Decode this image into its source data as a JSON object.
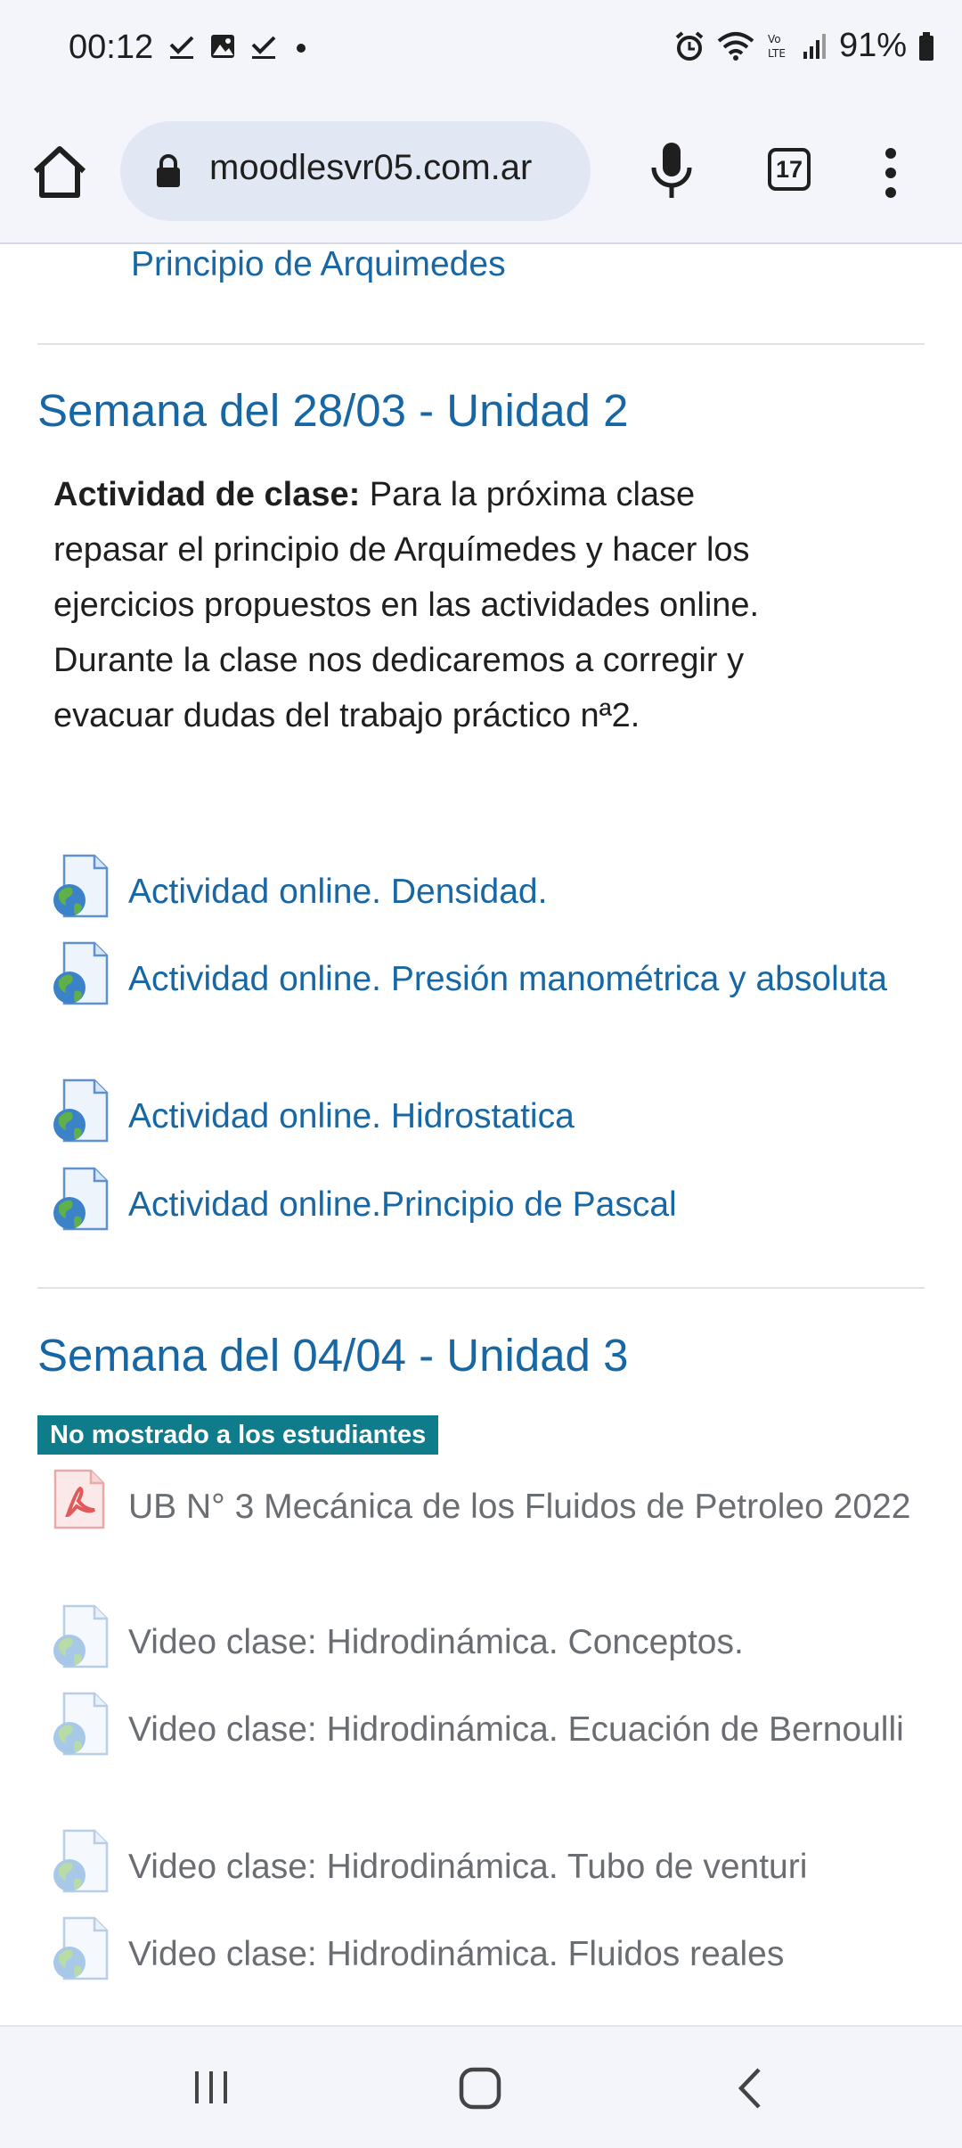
{
  "status_bar": {
    "time": "00:12",
    "battery": "91%",
    "icons": [
      "check-icon",
      "image-icon",
      "check-icon",
      "dot-icon",
      "alarm-icon",
      "wifi-icon",
      "volte-icon",
      "signal-icon",
      "battery-icon"
    ]
  },
  "browser": {
    "url": "moodlesvr05.com.ar",
    "tab_count": "17"
  },
  "page": {
    "previous_link": "Principio de Arquimedes",
    "sections": [
      {
        "title": "Semana del 28/03 - Unidad 2",
        "summary_bold": "Actividad de clase:",
        "summary_text": " Para la próxima clase repasar el principio de Arquímedes y hacer los ejercicios propuestos en las actividades online. Durante la clase nos dedicaremos a corregir y evacuar dudas del trabajo práctico nª2.",
        "activities": [
          {
            "label": "Actividad online. Densidad.",
            "icon": "web-page-icon"
          },
          {
            "label": "Actividad online. Presión manométrica y absoluta",
            "icon": "web-page-icon"
          },
          {
            "label": "Actividad online. Hidrostatica",
            "icon": "web-page-icon"
          },
          {
            "label": "Actividad online.Principio de Pascal",
            "icon": "web-page-icon"
          }
        ]
      },
      {
        "title": "Semana del 04/04 - Unidad 3",
        "badge": "No mostrado a los estudiantes",
        "activities": [
          {
            "label": "UB N° 3 Mecánica de los Fluidos de Petroleo 2022",
            "icon": "pdf-icon"
          },
          {
            "label": "Video clase: Hidrodinámica. Conceptos.",
            "icon": "web-page-icon"
          },
          {
            "label": "Video clase: Hidrodinámica. Ecuación de Bernoulli",
            "icon": "web-page-icon"
          },
          {
            "label": "Video clase: Hidrodinámica. Tubo de venturi",
            "icon": "web-page-icon"
          },
          {
            "label": "Video clase: Hidrodinámica. Fluidos reales",
            "icon": "web-page-icon"
          }
        ]
      }
    ]
  },
  "nav_bar": {
    "buttons": [
      "recents-icon",
      "home-icon",
      "back-icon"
    ]
  }
}
